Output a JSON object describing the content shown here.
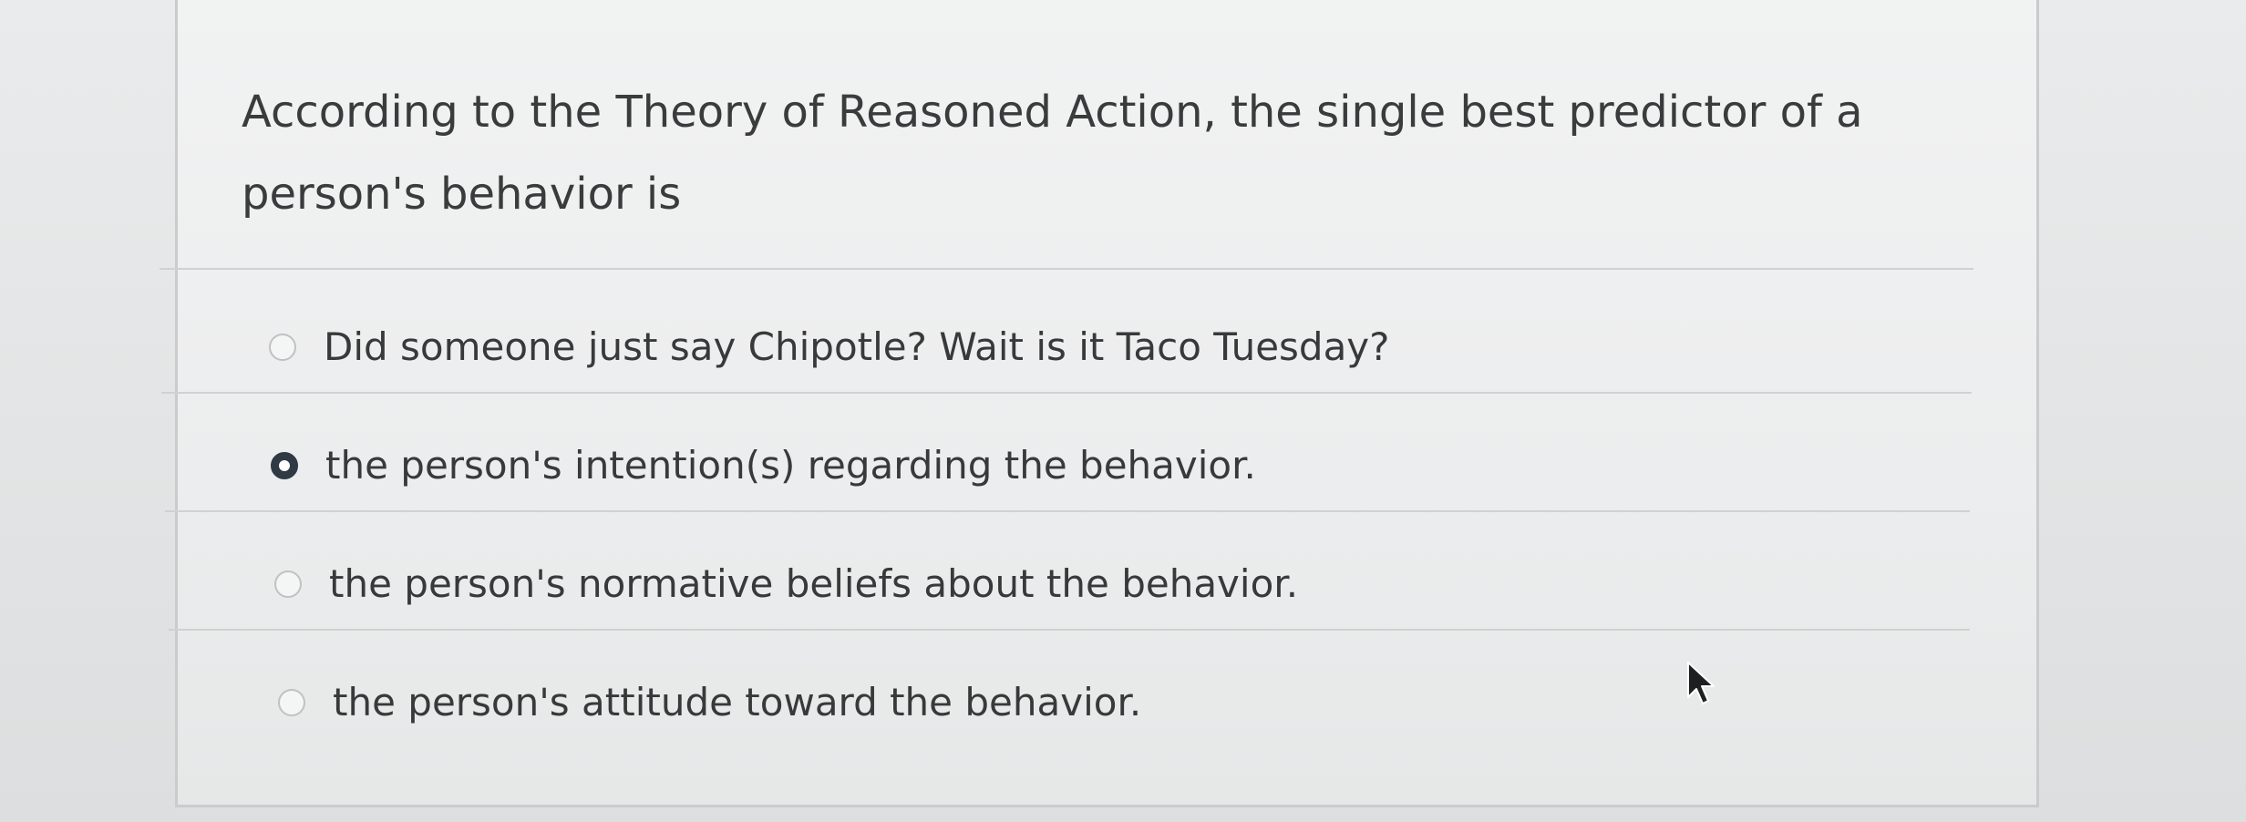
{
  "question": {
    "text": "According to the Theory of Reasoned Action, the single best predictor of a person's behavior is"
  },
  "answers": [
    {
      "label": "Did someone just say Chipotle? Wait is it Taco Tuesday?",
      "selected": false
    },
    {
      "label": "the person's intention(s) regarding the behavior.",
      "selected": true
    },
    {
      "label": "the person's normative beliefs about the behavior.",
      "selected": false
    },
    {
      "label": "the person's attitude toward the behavior.",
      "selected": false
    }
  ],
  "icons": {
    "radio_unselected": "radio-empty-icon",
    "radio_selected": "radio-filled-icon",
    "cursor": "mouse-pointer-icon"
  },
  "colors": {
    "text": "#3a3b3c",
    "selected_radio": "#2f3a44",
    "divider": "#cfd1d2"
  }
}
